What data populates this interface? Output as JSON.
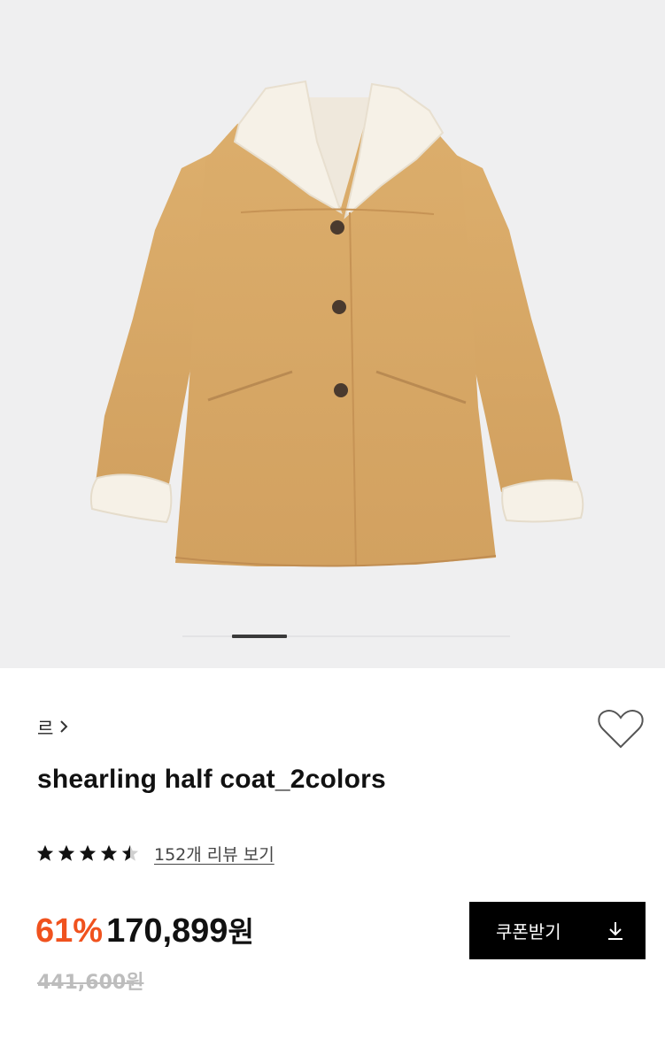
{
  "product": {
    "brand": "르",
    "title": "shearling half coat_2colors",
    "rating_value": 4.5,
    "review_link": "152개 리뷰 보기",
    "discount": "61%",
    "price": "170,899",
    "currency": "원",
    "original_price": "441,600원",
    "coupon_button": "쿠폰받기"
  },
  "gallery": {
    "image": "shearling-half-coat-photo",
    "active_index": 1,
    "slide_count": 5
  },
  "colors": {
    "accent_discount": "#f0521e",
    "button_bg": "#000000",
    "coat_suede": "#d9ab6c",
    "shearling": "#f6f1e7",
    "hero_bg": "#efeff0"
  },
  "icons": [
    "chevron-right-icon",
    "heart-icon",
    "star-icon",
    "download-icon"
  ]
}
